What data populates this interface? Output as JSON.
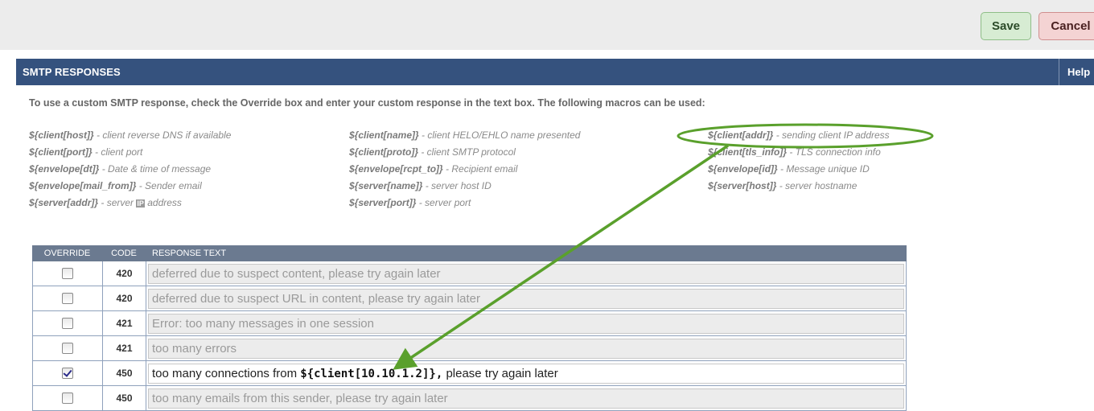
{
  "toolbar": {
    "save_label": "Save",
    "cancel_label": "Cancel"
  },
  "panel": {
    "title": "SMTP RESPONSES",
    "help_label": "Help"
  },
  "intro": "To use a custom SMTP response, check the Override box and enter your custom response in the text box. The following macros can be used:",
  "macros": [
    {
      "name": "${client[host]}",
      "desc": " - client reverse DNS if available"
    },
    {
      "name": "${client[port]}",
      "desc": " - client port"
    },
    {
      "name": "${envelope[dt]}",
      "desc": " - Date & time of message"
    },
    {
      "name": "${envelope[mail_from]}",
      "desc": " - Sender email"
    },
    {
      "name": "${server[addr]}",
      "desc_before": " - server ",
      "desc_highlight": "IP",
      "desc_after": " address"
    },
    {
      "name": "${client[name]}",
      "desc": " - client HELO/EHLO name presented"
    },
    {
      "name": "${client[proto]}",
      "desc": " - client SMTP protocol"
    },
    {
      "name": "${envelope[rcpt_to]}",
      "desc": " - Recipient email"
    },
    {
      "name": "${server[name]}",
      "desc": " - server host ID"
    },
    {
      "name": "${server[port]}",
      "desc": " - server port"
    },
    {
      "name": "${client[addr]}",
      "desc": " - sending client IP address"
    },
    {
      "name": "${client[tls_info]}",
      "desc": " - TLS connection info"
    },
    {
      "name": "${envelope[id]}",
      "desc": " - Message unique ID"
    },
    {
      "name": "${server[host]}",
      "desc": " - server hostname"
    }
  ],
  "table": {
    "headers": {
      "override": "OVERRIDE",
      "code": "CODE",
      "text": "RESPONSE TEXT"
    },
    "rows": [
      {
        "code": "420",
        "override": false,
        "text": "deferred due to suspect content, please try again later"
      },
      {
        "code": "420",
        "override": false,
        "text": "deferred due to suspect URL in content, please try again later"
      },
      {
        "code": "421",
        "override": false,
        "text": "Error: too many messages in one session"
      },
      {
        "code": "421",
        "override": false,
        "text": "too many errors"
      },
      {
        "code": "450",
        "override": true,
        "text_before": "too many connections from ",
        "text_macro": "${client[10.10.1.2]},",
        "text_after": " please try again later"
      },
      {
        "code": "450",
        "override": false,
        "text": "too many emails from this sender, please try again later"
      }
    ]
  },
  "annotation_color": "#5aa02c"
}
